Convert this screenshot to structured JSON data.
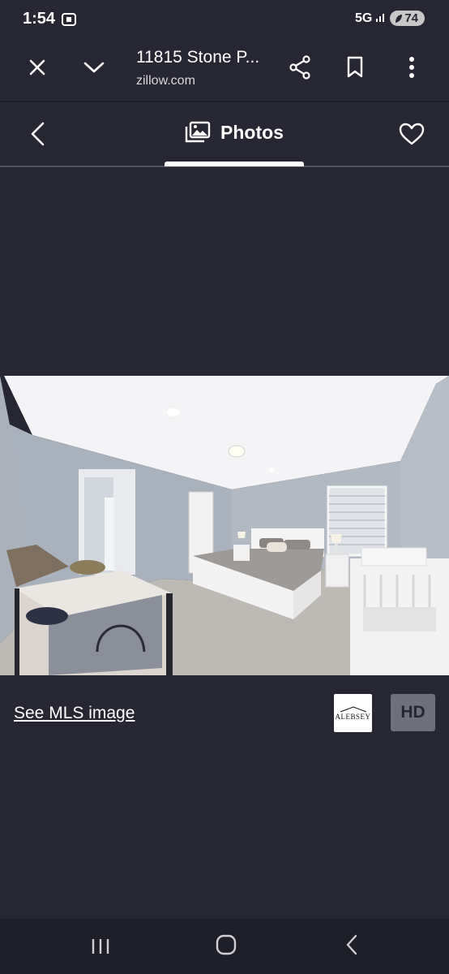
{
  "status": {
    "time": "1:54",
    "network": "5G",
    "battery": "74"
  },
  "browser": {
    "page_title": "11815 Stone P...",
    "domain": "zillow.com"
  },
  "photos_header": {
    "title": "Photos"
  },
  "photo_footer": {
    "mls_link": "See MLS image",
    "logo_text": "ALEBSEY",
    "hd_label": "HD"
  },
  "icons": [
    "close-icon",
    "chevron-down-icon",
    "share-icon",
    "bookmark-icon",
    "more-vert-icon",
    "back-arrow-icon",
    "photos-icon",
    "heart-icon",
    "recent-apps-icon",
    "home-icon",
    "back-icon"
  ]
}
